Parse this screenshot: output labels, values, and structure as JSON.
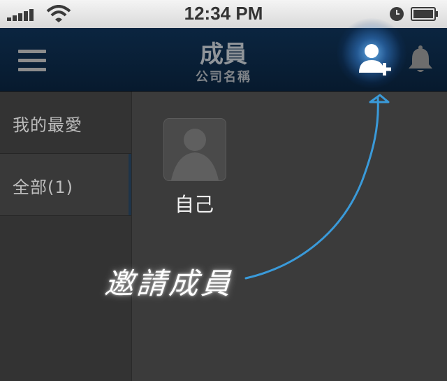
{
  "status_bar": {
    "time": "12:34 PM"
  },
  "navbar": {
    "title": "成員",
    "subtitle": "公司名稱",
    "icons": [
      "menu-icon",
      "add-user-icon",
      "bell-icon"
    ]
  },
  "sidebar": {
    "items": [
      {
        "label": "我的最愛",
        "active": false
      },
      {
        "label": "全部(1)",
        "active": true
      }
    ]
  },
  "main": {
    "members": [
      {
        "name": "自己",
        "avatar": "default-avatar-icon"
      }
    ]
  },
  "annotation": {
    "text": "邀請成員",
    "color": "#3a9ad9"
  },
  "colors": {
    "navbar": "#0b2540",
    "sidebar": "#333333",
    "main": "#3b3b3b",
    "glow": "#6ebeff"
  }
}
